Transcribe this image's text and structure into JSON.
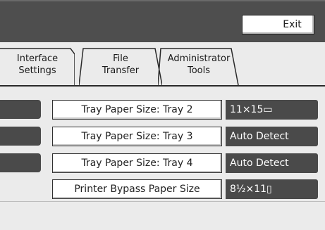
{
  "header": {
    "exit_label": "Exit"
  },
  "tabs": [
    {
      "label_line1": "Interface",
      "label_line2": "Settings"
    },
    {
      "label_line1": "File",
      "label_line2": "Transfer"
    },
    {
      "label_line1": "Administrator",
      "label_line2": "Tools"
    }
  ],
  "settings": [
    {
      "label": "Tray Paper Size: Tray 2",
      "value": "11×15▭"
    },
    {
      "label": "Tray Paper Size: Tray 3",
      "value": "Auto Detect"
    },
    {
      "label": "Tray Paper Size: Tray 4",
      "value": "Auto Detect"
    },
    {
      "label": "Printer Bypass Paper Size",
      "value": "8½×11▯"
    }
  ],
  "colors": {
    "header_bg": "#4e4e4e",
    "panel_bg": "#ebebeb",
    "value_bg": "#4a4a4a"
  }
}
